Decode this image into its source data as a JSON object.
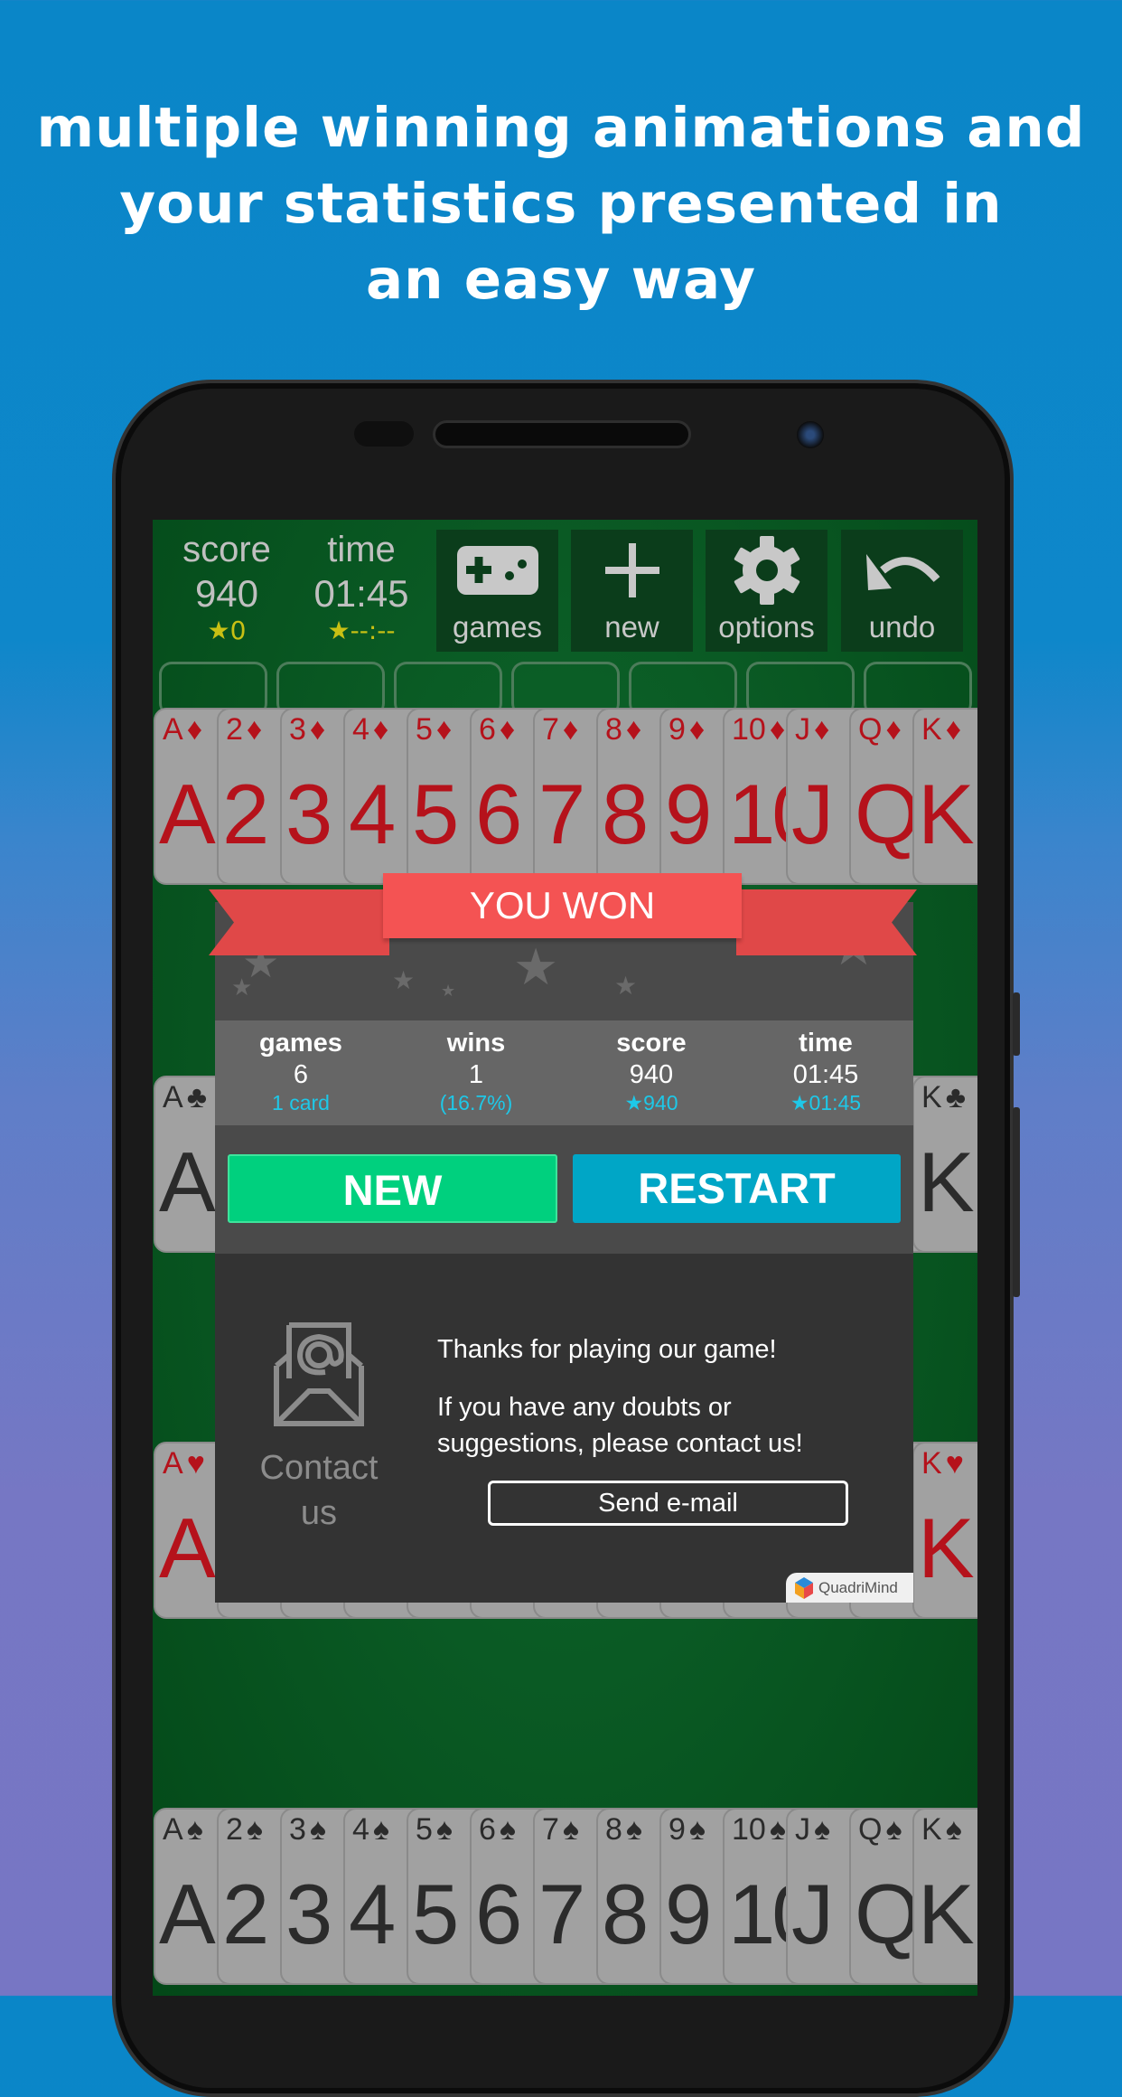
{
  "headline": [
    "multiple winning animations and",
    "your statistics presented in",
    "an easy way"
  ],
  "topbar": {
    "score_label": "score",
    "score_value": "940",
    "score_best": "★0",
    "time_label": "time",
    "time_value": "01:45",
    "time_best": "★--:--",
    "buttons": [
      {
        "label": "games",
        "icon": "gamepad-icon"
      },
      {
        "label": "new",
        "icon": "plus-icon"
      },
      {
        "label": "options",
        "icon": "gear-icon"
      },
      {
        "label": "undo",
        "icon": "undo-icon"
      }
    ]
  },
  "cards": {
    "ranks": [
      "A",
      "2",
      "3",
      "4",
      "5",
      "6",
      "7",
      "8",
      "9",
      "10",
      "J",
      "Q",
      "K"
    ],
    "rows": [
      {
        "suit": "♦",
        "color": "red"
      },
      {
        "suit": "♣",
        "color": "black"
      },
      {
        "suit": "♥",
        "color": "red"
      },
      {
        "suit": "♠",
        "color": "black"
      }
    ]
  },
  "dialog": {
    "title": "YOU WON",
    "stats": [
      {
        "label": "games",
        "value": "6",
        "sub": "1 card"
      },
      {
        "label": "wins",
        "value": "1",
        "sub": "(16.7%)"
      },
      {
        "label": "score",
        "value": "940",
        "sub": "★940"
      },
      {
        "label": "time",
        "value": "01:45",
        "sub": "★01:45"
      }
    ],
    "new_label": "NEW",
    "restart_label": "RESTART",
    "contact_label_1": "Contact",
    "contact_label_2": "us",
    "thanks": "Thanks for playing our game!",
    "doubts_1": "If you have any doubts or",
    "doubts_2": "suggestions, please contact us!",
    "send_label": "Send e-mail",
    "brand": "QuadriMind"
  },
  "colors": {
    "new": "#00d07e",
    "restart": "#00a6c6",
    "ribbon": "#f45353",
    "felt": "#0a5a24",
    "accent_sub": "#1ec8e8",
    "best_yellow": "#c8c014"
  }
}
